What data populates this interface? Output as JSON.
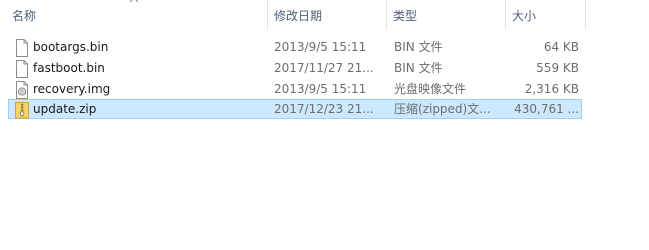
{
  "columns": {
    "name": "名称",
    "modified": "修改日期",
    "type": "类型",
    "size": "大小"
  },
  "files": [
    {
      "name": "bootargs.bin",
      "modified": "2013/9/5 15:11",
      "type": "BIN 文件",
      "size": "64 KB",
      "icon": "file-icon",
      "selected": false
    },
    {
      "name": "fastboot.bin",
      "modified": "2017/11/27 21...",
      "type": "BIN 文件",
      "size": "559 KB",
      "icon": "file-icon",
      "selected": false
    },
    {
      "name": "recovery.img",
      "modified": "2013/9/5 15:11",
      "type": "光盘映像文件",
      "size": "2,316 KB",
      "icon": "disc-image-icon",
      "selected": false
    },
    {
      "name": "update.zip",
      "modified": "2017/12/23 21...",
      "type": "压缩(zipped)文...",
      "size": "430,761 ...",
      "icon": "zip-folder-icon",
      "selected": true
    }
  ],
  "colors": {
    "header_text": "#4c607a",
    "selection_bg": "#cce8ff",
    "selection_border": "#99d1ff"
  }
}
